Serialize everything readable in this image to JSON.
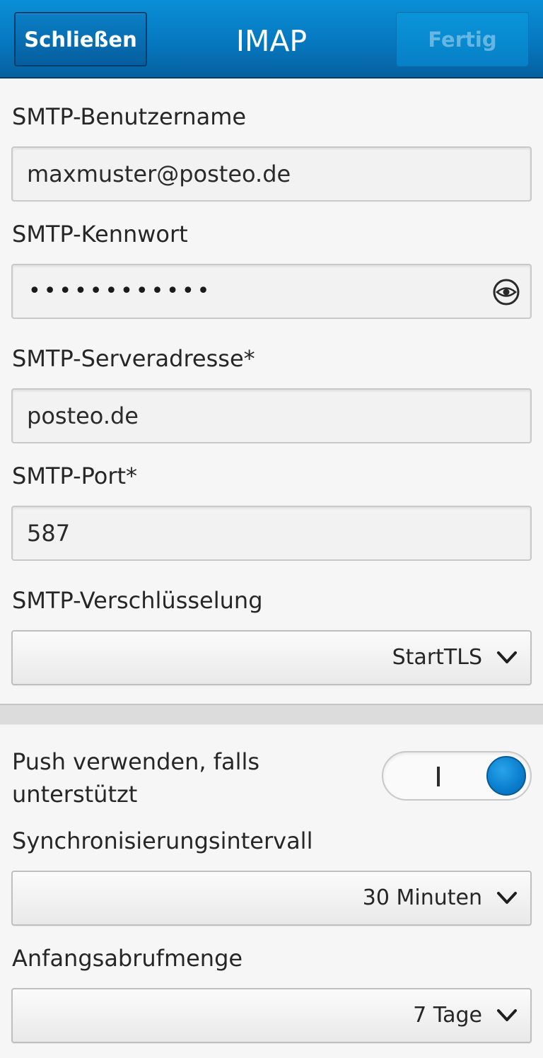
{
  "header": {
    "close_label": "Schließen",
    "title": "IMAP",
    "done_label": "Fertig"
  },
  "smtp_username": {
    "label": "SMTP-Benutzername",
    "value": "maxmuster@posteo.de"
  },
  "smtp_password": {
    "label": "SMTP-Kennwort",
    "masked_value": "••••••••••••",
    "reveal_icon": "eye-icon"
  },
  "smtp_server": {
    "label": "SMTP-Serveradresse*",
    "value": "posteo.de"
  },
  "smtp_port": {
    "label": "SMTP-Port*",
    "value": "587"
  },
  "smtp_encryption": {
    "label": "SMTP-Verschlüsselung",
    "selected": "StartTLS"
  },
  "push": {
    "label": "Push verwenden, falls unterstützt",
    "enabled": true
  },
  "sync_interval": {
    "label": "Synchronisierungsintervall",
    "selected": "30 Minuten"
  },
  "initial_fetch": {
    "label": "Anfangsabrufmenge",
    "selected": "7 Tage"
  },
  "colors": {
    "titlebar": "#0678c0",
    "toggle_knob": "#0a7dcc"
  }
}
